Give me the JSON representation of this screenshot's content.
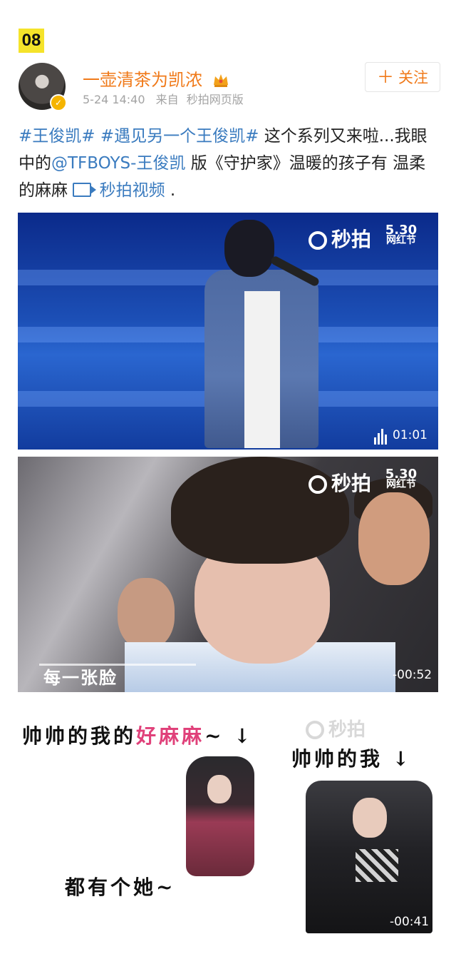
{
  "index_badge": "08",
  "post": {
    "username": "一壶清茶为凯浓",
    "time": "5-24 14:40",
    "source_prefix": "来自",
    "source": "秒拍网页版",
    "follow_label": "关注",
    "text": {
      "tag1": "#王俊凯#",
      "tag2": "#遇见另一个王俊凯#",
      "seg1": " 这个系列又来啦...我眼中的",
      "mention": "@TFBOYS-王俊凯",
      "seg2": " 版《守护家》温暖的孩子有 温柔的麻麻 ",
      "video_link": "秒拍视频",
      "seg3": " ."
    }
  },
  "media": {
    "watermark": "秒拍",
    "festival_top": "5.30",
    "festival_bottom": "网红节",
    "video1_duration": "01:01",
    "video2_caption": "每一张脸",
    "video2_duration": "-00:52",
    "video3_line1_black": "帅帅的我的",
    "video3_line1_pink": "好麻麻",
    "video3_line1_tail": "~ ↓",
    "video3_line2": "帅帅的我 ↓",
    "video3_line3": "都有个她~",
    "video3_duration": "-00:41"
  },
  "icons": {
    "crown": "crown-icon",
    "verified": "verified-badge-icon",
    "video": "video-link-icon",
    "bars": "audio-bars-icon"
  },
  "colors": {
    "username": "#f07a1a",
    "link": "#3a7bbf",
    "badge": "#f5e32a",
    "meta": "#a3a3a3"
  }
}
